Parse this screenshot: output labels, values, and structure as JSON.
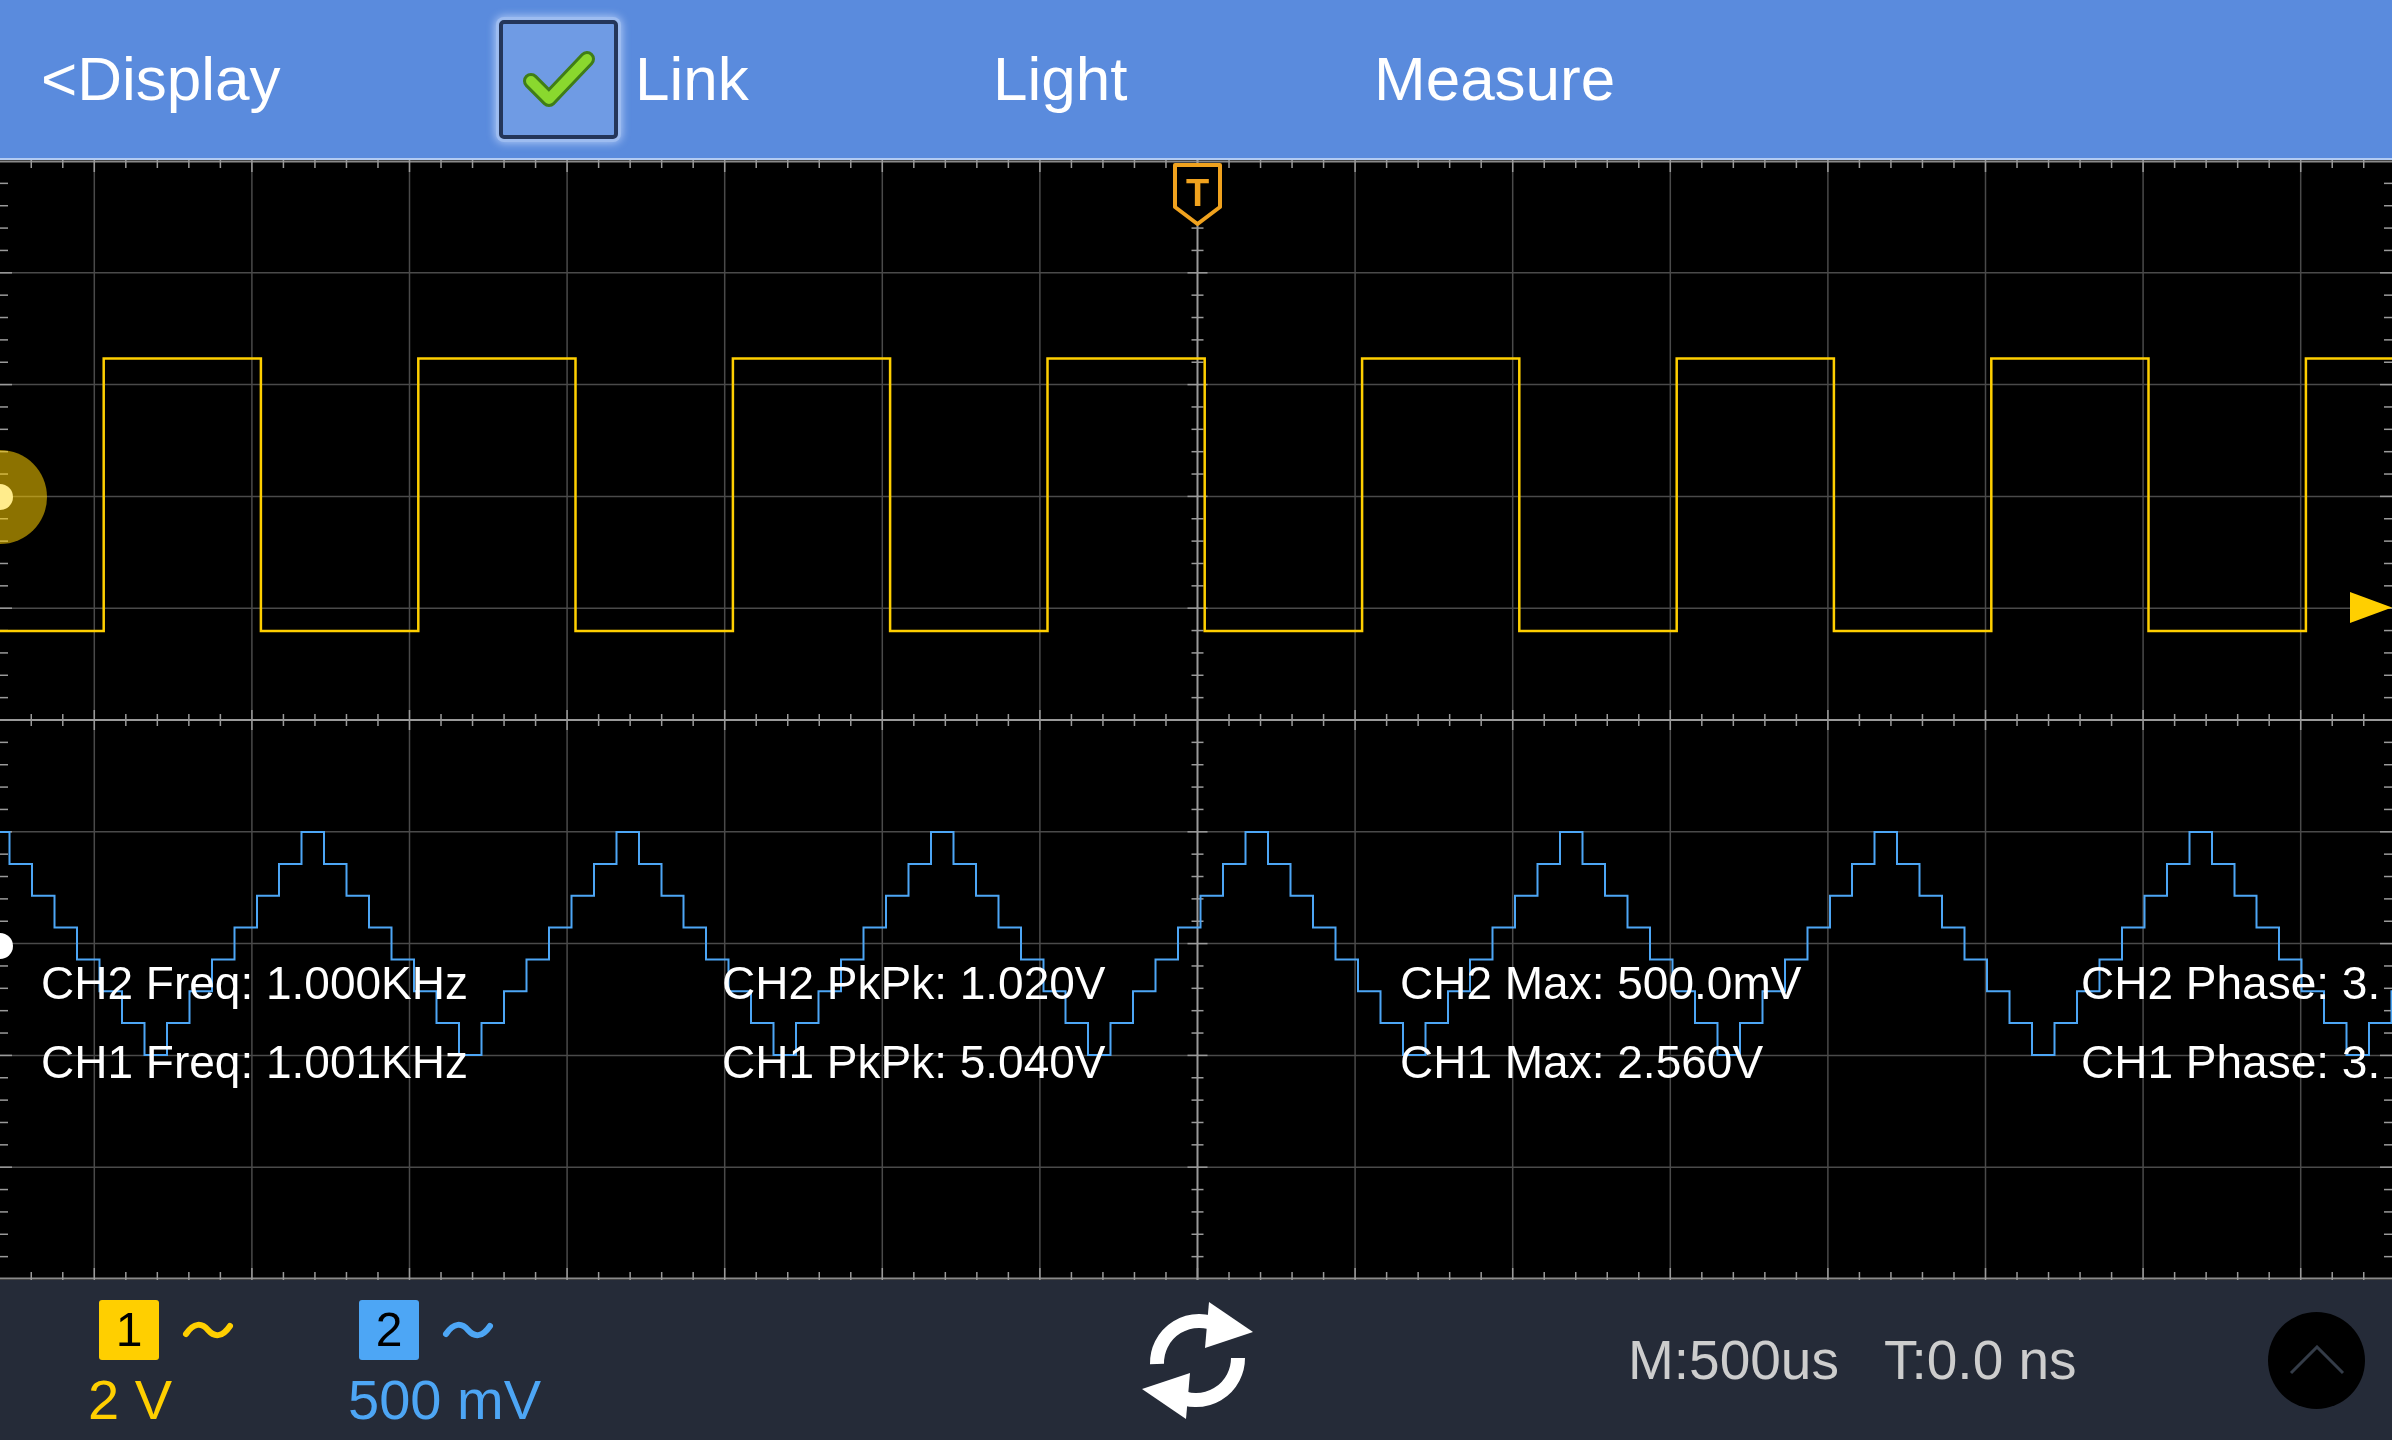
{
  "top_bar": {
    "back": "<Display",
    "link": {
      "label": "Link",
      "checked": true
    },
    "menu": [
      "Light",
      "Measure"
    ]
  },
  "screen": {
    "trigger_marker": "T",
    "measurements": [
      {
        "lines": [
          "CH2 Freq: 1.000KHz",
          "CH1 Freq: 1.001KHz"
        ]
      },
      {
        "lines": [
          "CH2 PkPk: 1.020V",
          "CH1 PkPk: 5.040V"
        ]
      },
      {
        "lines": [
          "CH2 Max: 500.0mV",
          "CH1 Max: 2.560V"
        ]
      },
      {
        "lines": [
          "CH2 Phase: 3.",
          "CH1 Phase: 3."
        ]
      }
    ]
  },
  "channels": [
    {
      "number": "1",
      "scale": "2 V",
      "color": "#ffcf00"
    },
    {
      "number": "2",
      "scale": "500 mV",
      "color": "#4da6f5"
    }
  ],
  "status_bar": {
    "timebase": "M:500us",
    "trigger_time": "T:0.0 ns"
  }
}
